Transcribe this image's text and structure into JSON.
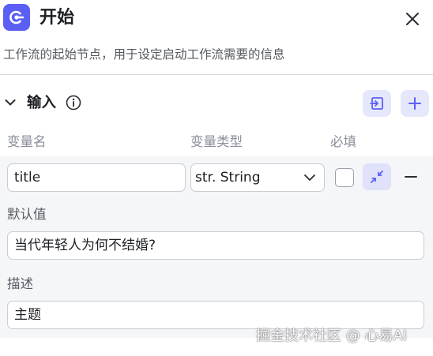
{
  "header": {
    "title": "开始",
    "app_icon": "workflow-start-icon",
    "close_icon": "close-icon"
  },
  "description": "工作流的起始节点，用于设定启动工作流需要的信息",
  "input_section": {
    "title": "输入",
    "columns": {
      "name": "变量名",
      "type": "变量类型",
      "required": "必填"
    },
    "variable": {
      "name": "title",
      "type": "str. String",
      "required": false
    },
    "default_label": "默认值",
    "default_value": "当代年轻人为何不结婚?",
    "desc_label": "描述",
    "desc_value": "主题"
  },
  "watermark": "掘金技术社区 @ 心易AI",
  "colors": {
    "accent": "#5b5ff5",
    "accent_light": "#e5e7fb",
    "card_bg": "#f5f6f8"
  }
}
